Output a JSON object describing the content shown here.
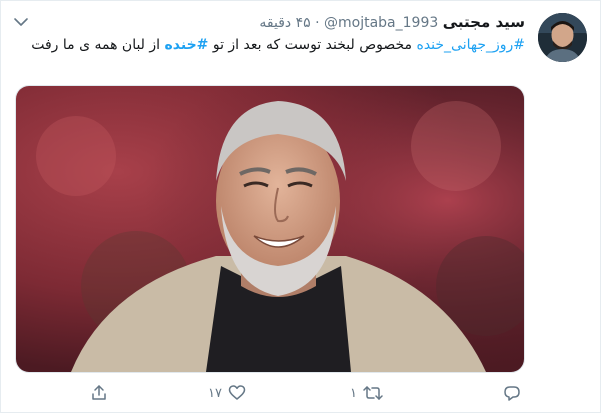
{
  "tweet": {
    "display_name": "سید مجتبی",
    "handle": "@mojtaba_1993",
    "separator": "·",
    "time": "۴۵ دقیقه",
    "text_segments": {
      "hashtag_1": "#روز_جهانی_خنده",
      "text_1": " مخصوص لبخند توست که بعد از تو ",
      "hashtag_2": "#خنده",
      "text_2": " از لبان همه ی ما رفت"
    }
  },
  "actions": {
    "reply": {
      "icon": "reply-icon",
      "count": ""
    },
    "retweet": {
      "icon": "retweet-icon",
      "count": "۱"
    },
    "like": {
      "icon": "heart-icon",
      "count": "۱۷"
    },
    "share": {
      "icon": "share-icon",
      "count": ""
    }
  },
  "colors": {
    "link": "#1da1f2",
    "secondary_text": "#657786",
    "primary_text": "#14171a"
  }
}
